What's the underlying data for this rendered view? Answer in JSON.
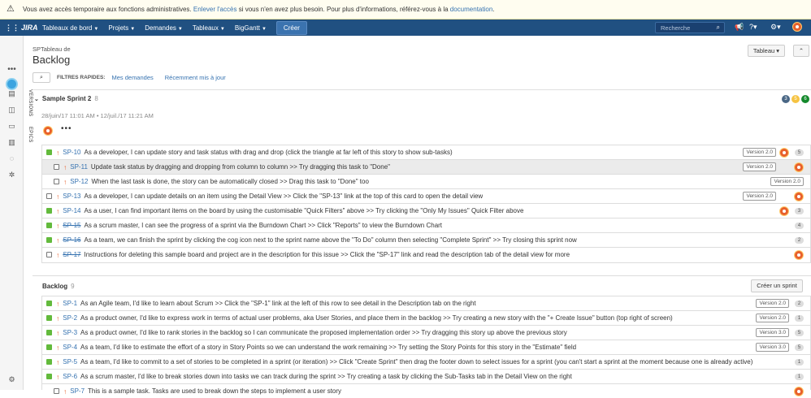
{
  "banner": {
    "text_before": "Vous avez accès temporaire aux fonctions administratives.",
    "link1": "Enlever l'accès",
    "text_middle": "si vous n'en avez plus besoin. Pour plus d'informations, référez-vous à la",
    "link2": "documentation",
    "text_end": "."
  },
  "topnav": {
    "logo": "JIRA",
    "items": [
      "Tableaux de bord",
      "Projets",
      "Demandes",
      "Tableaux",
      "BigGantt"
    ],
    "create": "Créer",
    "search_placeholder": "Recherche"
  },
  "header": {
    "breadcrumb": "SPTableau de",
    "title": "Backlog",
    "board_button": "Tableau",
    "collapse_icon": "collapse-icon"
  },
  "quickfilters": {
    "label": "FILTRES RAPIDES:",
    "filters": [
      "Mes demandes",
      "Récemment mis à jour"
    ]
  },
  "side_tabs": {
    "versions": "VERSIONS",
    "epics": "EPICS"
  },
  "sprint": {
    "name": "Sample Sprint 2",
    "count": "8",
    "dates": "28/juin/17 11:01 AM  •  12/juil./17 11:21 AM",
    "status_counts": [
      {
        "value": "3",
        "color": "#4a6785"
      },
      {
        "value": "5",
        "color": "#f6c342"
      },
      {
        "value": "6",
        "color": "#14892c"
      }
    ],
    "issues": [
      {
        "type": "story",
        "key": "SP-10",
        "done": false,
        "summary": "As a developer, I can update story and task status with drag and drop (click the triangle at far left of this story to show sub-tasks)",
        "version": "Version 2.0",
        "avatar": true,
        "estimate": "5",
        "sub": false,
        "selected": false
      },
      {
        "type": "task",
        "key": "SP-11",
        "done": false,
        "summary": "Update task status by dragging and dropping from column to column >> Try dragging this task to \"Done\"",
        "version": "Version 2.0",
        "avatar": true,
        "estimate": "",
        "sub": true,
        "selected": true
      },
      {
        "type": "task",
        "key": "SP-12",
        "done": false,
        "summary": "When the last task is done, the story can be automatically closed >> Drag this task to \"Done\" too",
        "version": "Version 2.0",
        "avatar": false,
        "estimate": "",
        "sub": true,
        "selected": false
      },
      {
        "type": "task",
        "key": "SP-13",
        "done": false,
        "summary": "As a developer, I can update details on an item using the Detail View >> Click the \"SP-13\" link at the top of this card to open the detail view",
        "version": "Version 2.0",
        "avatar": true,
        "estimate": "",
        "sub": false,
        "selected": false
      },
      {
        "type": "story",
        "key": "SP-14",
        "done": false,
        "summary": "As a user, I can find important items on the board by using the customisable \"Quick Filters\" above >> Try clicking the \"Only My Issues\" Quick Filter above",
        "version": "",
        "avatar": true,
        "estimate": "3",
        "sub": false,
        "selected": false
      },
      {
        "type": "story",
        "key": "SP-15",
        "done": true,
        "summary": "As a scrum master, I can see the progress of a sprint via the Burndown Chart >> Click \"Reports\" to view the Burndown Chart",
        "version": "",
        "avatar": false,
        "estimate": "4",
        "sub": false,
        "selected": false
      },
      {
        "type": "story",
        "key": "SP-16",
        "done": true,
        "summary": "As a team, we can finish the sprint by clicking the cog icon next to the sprint name above the \"To Do\" column then selecting \"Complete Sprint\" >> Try closing this sprint now",
        "version": "",
        "avatar": false,
        "estimate": "2",
        "sub": false,
        "selected": false
      },
      {
        "type": "task",
        "key": "SP-17",
        "done": true,
        "summary": "Instructions for deleting this sample board and project are in the description for this issue >> Click the \"SP-17\" link and read the description tab of the detail view for more",
        "version": "",
        "avatar": true,
        "estimate": "",
        "sub": false,
        "selected": false
      }
    ]
  },
  "backlog": {
    "name": "Backlog",
    "count": "9",
    "create_sprint": "Créer un sprint",
    "issues": [
      {
        "type": "story",
        "key": "SP-1",
        "done": false,
        "summary": "As an Agile team, I'd like to learn about Scrum >> Click the \"SP-1\" link at the left of this row to see detail in the Description tab on the right",
        "version": "Version 2.0",
        "avatar": false,
        "estimate": "2",
        "sub": false,
        "selected": false
      },
      {
        "type": "story",
        "key": "SP-2",
        "done": false,
        "summary": "As a product owner, I'd like to express work in terms of actual user problems, aka User Stories, and place them in the backlog >> Try creating a new story with the \"+ Create Issue\" button (top right of screen)",
        "version": "Version 2.0",
        "avatar": false,
        "estimate": "1",
        "sub": false,
        "selected": false
      },
      {
        "type": "story",
        "key": "SP-3",
        "done": false,
        "summary": "As a product owner, I'd like to rank stories in the backlog so I can communicate the proposed implementation order >> Try dragging this story up above the previous story",
        "version": "Version 3.0",
        "avatar": false,
        "estimate": "5",
        "sub": false,
        "selected": false
      },
      {
        "type": "story",
        "key": "SP-4",
        "done": false,
        "summary": "As a team, I'd like to estimate the effort of a story in Story Points so we can understand the work remaining >> Try setting the Story Points for this story in the \"Estimate\" field",
        "version": "Version 3.0",
        "avatar": false,
        "estimate": "5",
        "sub": false,
        "selected": false
      },
      {
        "type": "story",
        "key": "SP-5",
        "done": false,
        "summary": "As a team, I'd like to commit to a set of stories to be completed in a sprint (or iteration) >> Click \"Create Sprint\" then drag the footer down to select issues for a sprint (you can't start a sprint at the moment because one is already active)",
        "version": "",
        "avatar": false,
        "estimate": "1",
        "sub": false,
        "selected": false
      },
      {
        "type": "story",
        "key": "SP-6",
        "done": false,
        "summary": "As a scrum master, I'd like to break stories down into tasks we can track during the sprint >> Try creating a task by clicking the Sub-Tasks tab in the Detail View on the right",
        "version": "",
        "avatar": false,
        "estimate": "1",
        "sub": false,
        "selected": false
      },
      {
        "type": "task",
        "key": "SP-7",
        "done": false,
        "summary": "This is a sample task. Tasks are used to break down the steps to implement a user story",
        "version": "",
        "avatar": true,
        "estimate": "",
        "sub": true,
        "selected": false
      }
    ]
  }
}
